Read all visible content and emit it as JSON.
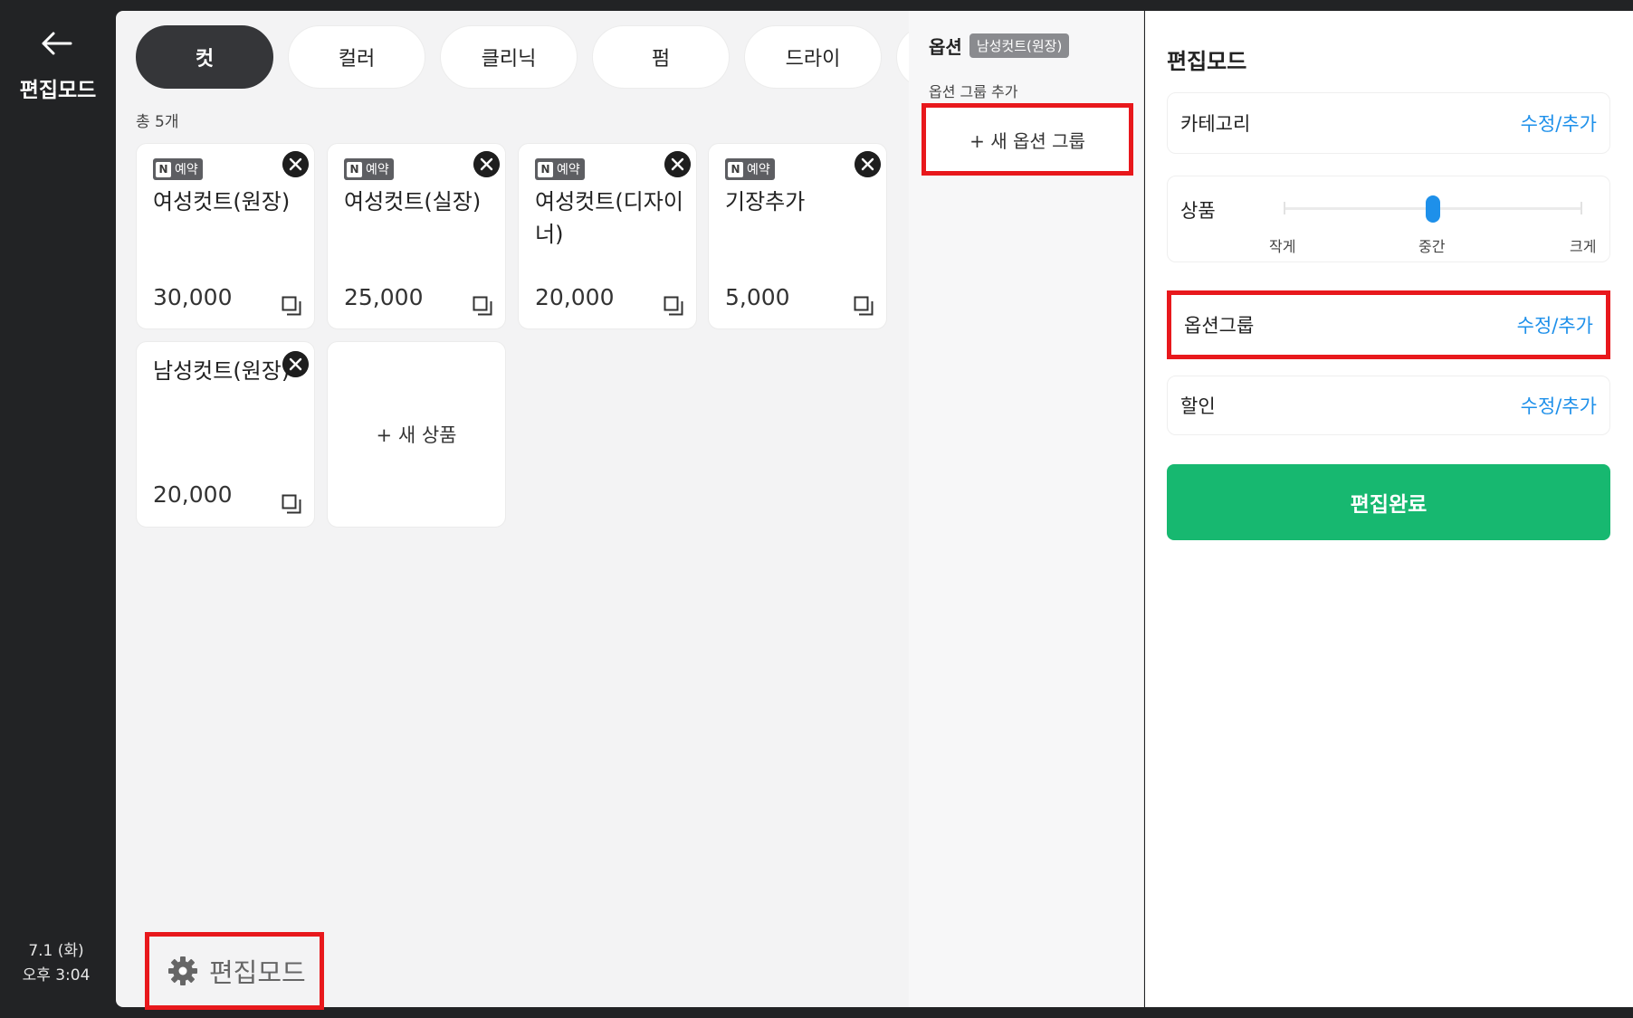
{
  "sidebar": {
    "back_icon": "arrow-left-icon",
    "title": "편집모드",
    "date": "7.1 (화)",
    "time": "오후 3:04"
  },
  "tabs": [
    {
      "label": "컷",
      "active": true
    },
    {
      "label": "컬러"
    },
    {
      "label": "클리닉"
    },
    {
      "label": "펌"
    },
    {
      "label": "드라이"
    }
  ],
  "list": {
    "count_label": "총 5개",
    "badge_n": "N",
    "badge_text": "예약",
    "products": [
      {
        "name": "여성컷트(원장)",
        "price": "30,000",
        "badge": true
      },
      {
        "name": "여성컷트(실장)",
        "price": "25,000",
        "badge": true
      },
      {
        "name": "여성컷트(디자이너)",
        "price": "20,000",
        "badge": true
      },
      {
        "name": "기장추가",
        "price": "5,000",
        "badge": true
      },
      {
        "name": "남성컷트(원장)",
        "price": "20,000",
        "badge": false
      }
    ],
    "new_product_label": "+ 새 상품"
  },
  "footer": {
    "edit_mode_label": "편집모드",
    "icon": "gear-icon"
  },
  "options": {
    "title": "옵션",
    "selected_product": "남성컷트(원장)",
    "section_label": "옵션 그룹 추가",
    "new_group_label": "+ 새 옵션 그룹"
  },
  "settings": {
    "title": "편집모드",
    "category_label": "카테고리",
    "category_action": "수정/추가",
    "product_size_label": "상품",
    "size_options": [
      "작게",
      "중간",
      "크게"
    ],
    "size_selected": "중간",
    "option_group_label": "옵션그룹",
    "option_group_action": "수정/추가",
    "discount_label": "할인",
    "discount_action": "수정/추가",
    "done_label": "편집완료"
  },
  "colors": {
    "accent_green": "#17b870",
    "link_blue": "#1e90ea",
    "highlight_red": "#e8181c",
    "dark": "#222325"
  }
}
